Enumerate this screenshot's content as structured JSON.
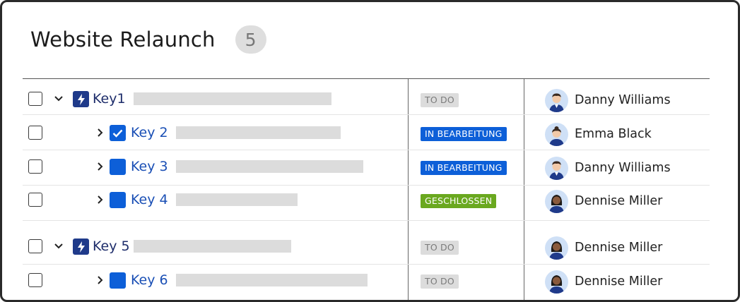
{
  "header": {
    "title": "Website Relaunch",
    "count": "5"
  },
  "rows": [
    {
      "key": "Key1",
      "type": "epic",
      "status": "TO DO",
      "status_kind": "todo",
      "assignee": "Danny Williams",
      "avatar": "man-avatar"
    },
    {
      "key": "Key 2",
      "type": "task-done",
      "status": "IN BEARBEITUNG",
      "status_kind": "progress",
      "assignee": "Emma Black",
      "avatar": "woman-avatar"
    },
    {
      "key": "Key 3",
      "type": "story",
      "status": "IN BEARBEITUNG",
      "status_kind": "progress",
      "assignee": "Danny Williams",
      "avatar": "man-avatar"
    },
    {
      "key": "Key 4",
      "type": "story",
      "status": "GESCHLOSSEN",
      "status_kind": "done",
      "assignee": "Dennise Miller",
      "avatar": "woman-dark-avatar"
    },
    {
      "key": "Key 5",
      "type": "epic",
      "status": "TO DO",
      "status_kind": "todo",
      "assignee": "Dennise Miller",
      "avatar": "woman-dark-avatar"
    },
    {
      "key": "Key 6",
      "type": "story",
      "status": "TO DO",
      "status_kind": "todo",
      "assignee": "Dennise Miller",
      "avatar": "woman-dark-avatar"
    }
  ],
  "colors": {
    "epic": "#1f3a8a",
    "story": "#0d5fd8",
    "status_todo": "#dcdcdc",
    "status_progress": "#0d5fd8",
    "status_done": "#6aa81f",
    "key_link": "#1a4fb5"
  }
}
